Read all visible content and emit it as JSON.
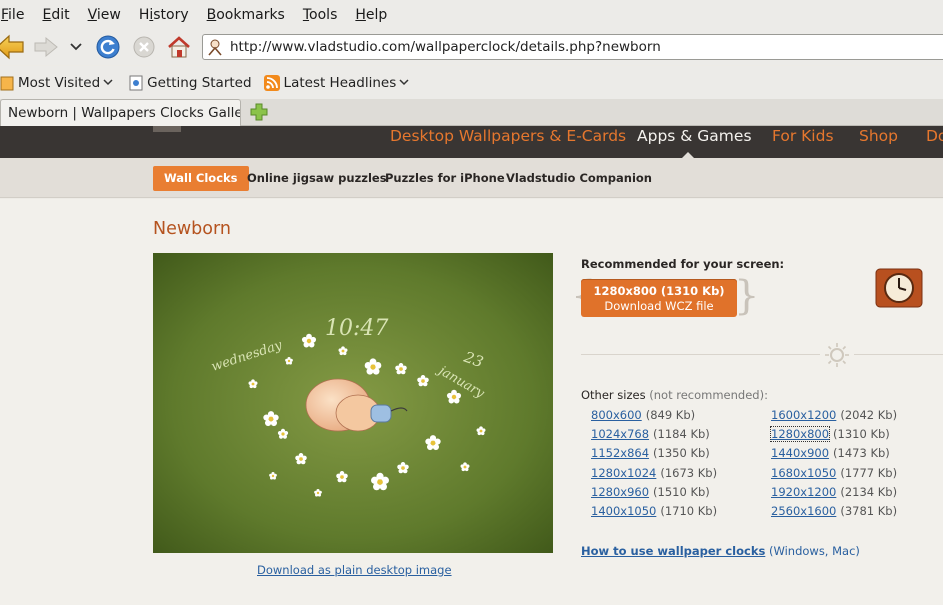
{
  "browser": {
    "menu": [
      {
        "label": "File",
        "underline": "F",
        "rest": "ile"
      },
      {
        "label": "Edit",
        "underline": "E",
        "rest": "dit"
      },
      {
        "label": "View",
        "underline": "V",
        "rest": "iew"
      },
      {
        "label": "History",
        "underline": "H",
        "rest": "istory",
        "pre": ""
      },
      {
        "label": "Bookmarks",
        "underline": "B",
        "rest": "ookmarks"
      },
      {
        "label": "Tools",
        "underline": "T",
        "rest": "ools"
      },
      {
        "label": "Help",
        "underline": "H",
        "rest": "elp"
      }
    ],
    "url": "http://www.vladstudio.com/wallpaperclock/details.php?newborn",
    "bookmarks": {
      "most_visited": "Most Visited",
      "getting_started": "Getting Started",
      "latest_headlines": "Latest Headlines"
    },
    "tab_title": "Newborn | Wallpapers Clocks Galle…"
  },
  "site": {
    "nav": {
      "desktop": "Desktop Wallpapers & E-Cards",
      "apps": "Apps & Games",
      "kids": "For Kids",
      "shop": "Shop",
      "more": "Do"
    },
    "subnav": {
      "wall_clocks": "Wall Clocks",
      "jigsaw": "Online jigsaw puzzles",
      "iphone": "Puzzles for iPhone",
      "companion": "Vladstudio Companion"
    }
  },
  "page": {
    "title": "Newborn",
    "wallpaper": {
      "time": "10:47",
      "weekday": "wednesday",
      "day": "23",
      "month": "january"
    },
    "plain_link": "Download as plain desktop image",
    "recommended_label": "Recommended for your screen:",
    "download": {
      "size": "1280x800",
      "kb": "(1310 Kb)",
      "label": "Download WCZ file"
    },
    "other_sizes_label": "Other sizes",
    "other_sizes_note": "(not recommended):",
    "sizes_left": [
      {
        "res": "800x600",
        "kb": "(849 Kb)"
      },
      {
        "res": "1024x768",
        "kb": "(1184 Kb)"
      },
      {
        "res": "1152x864",
        "kb": "(1350 Kb)"
      },
      {
        "res": "1280x1024",
        "kb": "(1673 Kb)"
      },
      {
        "res": "1280x960",
        "kb": "(1510 Kb)"
      },
      {
        "res": "1400x1050",
        "kb": "(1710 Kb)"
      }
    ],
    "sizes_right": [
      {
        "res": "1600x1200",
        "kb": "(2042 Kb)"
      },
      {
        "res": "1280x800",
        "kb": "(1310 Kb)"
      },
      {
        "res": "1440x900",
        "kb": "(1473 Kb)"
      },
      {
        "res": "1680x1050",
        "kb": "(1777 Kb)"
      },
      {
        "res": "1920x1200",
        "kb": "(2134 Kb)"
      },
      {
        "res": "2560x1600",
        "kb": "(3781 Kb)"
      }
    ],
    "howto_link": "How to use wallpaper clocks",
    "howto_note": "(Windows, Mac)"
  },
  "colors": {
    "accent": "#e0722a",
    "nav_bg": "#393533",
    "link": "#2a60a0"
  }
}
